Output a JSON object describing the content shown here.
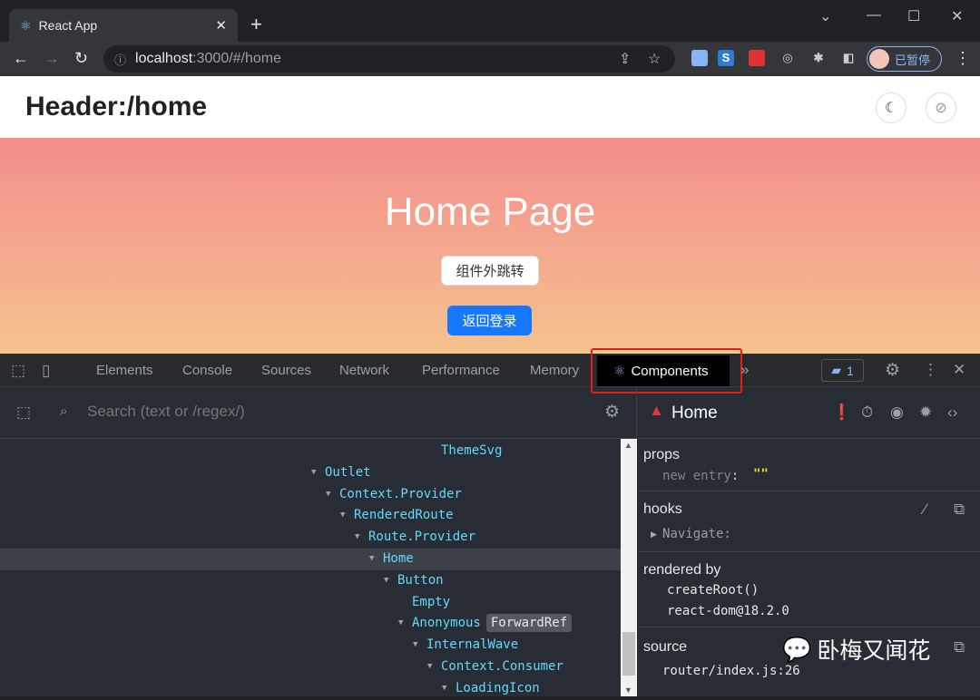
{
  "browser": {
    "tab_title": "React App",
    "url_host": "localhost",
    "url_path": ":3000/#/home",
    "profile_label": "已暂停"
  },
  "page": {
    "header_title": "Header:/home",
    "home_title": "Home Page",
    "button_outside": "组件外跳转",
    "button_back": "返回登录"
  },
  "devtools": {
    "tabs": [
      "Elements",
      "Console",
      "Sources",
      "Network",
      "Performance",
      "Memory",
      "Components"
    ],
    "active_tab": "Components",
    "message_count": "1",
    "search_placeholder": "Search (text or /regex/)",
    "tree": [
      {
        "name": "ThemeSvg",
        "depth": 8,
        "expanded": false
      },
      {
        "name": "Outlet",
        "depth": 0,
        "expanded": true
      },
      {
        "name": "Context.Provider",
        "depth": 1,
        "expanded": true
      },
      {
        "name": "RenderedRoute",
        "depth": 2,
        "expanded": true
      },
      {
        "name": "Route.Provider",
        "depth": 3,
        "expanded": true
      },
      {
        "name": "Home",
        "depth": 4,
        "expanded": true,
        "selected": true
      },
      {
        "name": "Button",
        "depth": 5,
        "expanded": true
      },
      {
        "name": "Empty",
        "depth": 6,
        "expanded": false
      },
      {
        "name": "Anonymous",
        "depth": 6,
        "expanded": true,
        "badge": "ForwardRef"
      },
      {
        "name": "InternalWave",
        "depth": 7,
        "expanded": true
      },
      {
        "name": "Context.Consumer",
        "depth": 8,
        "expanded": true
      },
      {
        "name": "LoadingIcon",
        "depth": 9,
        "expanded": true
      }
    ],
    "inspector": {
      "component": "Home",
      "props_title": "props",
      "prop_key": "new entry",
      "prop_value": "\"\"",
      "hooks_title": "hooks",
      "hook": "Navigate:",
      "rendered_by_title": "rendered by",
      "rendered_by": [
        "createRoot()",
        "react-dom@18.2.0"
      ],
      "source_title": "source",
      "source": "router/index.js:26"
    }
  },
  "watermark": "卧梅又闻花"
}
